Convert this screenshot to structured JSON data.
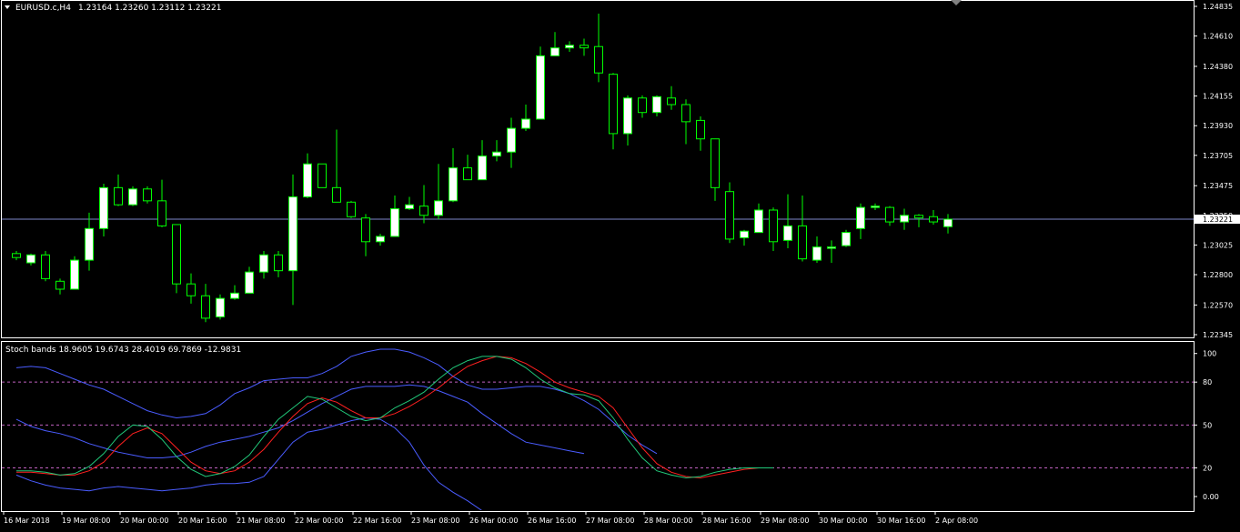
{
  "header": {
    "symbol_label": "EURUSD.c,H4",
    "ohlc": "1.23164 1.23260 1.23112 1.23221"
  },
  "indicator": {
    "label": "Stoch bands 18.9605 19.6743 28.4019 69.7869 -12.9831",
    "levels": [
      "100",
      "80",
      "50",
      "20",
      "0.00"
    ],
    "level_values": [
      100,
      80,
      50,
      20,
      0
    ]
  },
  "colors": {
    "background": "#000000",
    "frame": "#ffffff",
    "bull_body": "#ffffff",
    "wick": "#00ff00",
    "current_price_line": "#7b86c8",
    "price_tag_bg": "#ffffff",
    "band_line": "#4a5cff",
    "stoch_main": "#21c97a",
    "stoch_signal": "#ff2020",
    "level_line": "#c060c0"
  },
  "price_axis": {
    "labels": [
      "1.24835",
      "1.24610",
      "1.24380",
      "1.24155",
      "1.23930",
      "1.23705",
      "1.23475",
      "1.23250",
      "1.23025",
      "1.22800",
      "1.22570",
      "1.22345"
    ],
    "values": [
      1.24835,
      1.2461,
      1.2438,
      1.24155,
      1.2393,
      1.23705,
      1.23475,
      1.2325,
      1.23025,
      1.228,
      1.2257,
      1.22345
    ],
    "current_price": "1.23221",
    "current_value": 1.23221
  },
  "time_axis": {
    "labels": [
      "16 Mar 2018",
      "19 Mar 08:00",
      "20 Mar 00:00",
      "20 Mar 16:00",
      "21 Mar 08:00",
      "22 Mar 00:00",
      "22 Mar 16:00",
      "23 Mar 08:00",
      "26 Mar 00:00",
      "26 Mar 16:00",
      "27 Mar 08:00",
      "28 Mar 00:00",
      "28 Mar 16:00",
      "29 Mar 08:00",
      "30 Mar 00:00",
      "30 Mar 16:00",
      "2 Apr 08:00"
    ],
    "bar_index": [
      0,
      4,
      8,
      12,
      16,
      20,
      24,
      28,
      32,
      36,
      40,
      44,
      48,
      52,
      56,
      60,
      64
    ]
  },
  "chart_data": {
    "type": "candlestick",
    "symbol": "EURUSD.c",
    "timeframe": "H4",
    "ylim": [
      1.22345,
      1.24835
    ],
    "candles": [
      {
        "o": 1.2296,
        "h": 1.2298,
        "l": 1.2291,
        "c": 1.2293
      },
      {
        "o": 1.2289,
        "h": 1.2296,
        "l": 1.2287,
        "c": 1.2295
      },
      {
        "o": 1.2295,
        "h": 1.2298,
        "l": 1.2275,
        "c": 1.2277
      },
      {
        "o": 1.2275,
        "h": 1.2277,
        "l": 1.2265,
        "c": 1.2269
      },
      {
        "o": 1.2269,
        "h": 1.2294,
        "l": 1.2269,
        "c": 1.2291
      },
      {
        "o": 1.2291,
        "h": 1.2327,
        "l": 1.2283,
        "c": 1.2315
      },
      {
        "o": 1.2315,
        "h": 1.2349,
        "l": 1.2309,
        "c": 1.2346
      },
      {
        "o": 1.2346,
        "h": 1.2356,
        "l": 1.2332,
        "c": 1.2333
      },
      {
        "o": 1.2333,
        "h": 1.2347,
        "l": 1.2332,
        "c": 1.2345
      },
      {
        "o": 1.2345,
        "h": 1.2347,
        "l": 1.2334,
        "c": 1.2336
      },
      {
        "o": 1.2336,
        "h": 1.2352,
        "l": 1.2316,
        "c": 1.2317
      },
      {
        "o": 1.2318,
        "h": 1.2318,
        "l": 1.2266,
        "c": 1.2273
      },
      {
        "o": 1.2273,
        "h": 1.2281,
        "l": 1.2258,
        "c": 1.2264
      },
      {
        "o": 1.2264,
        "h": 1.2273,
        "l": 1.2244,
        "c": 1.2247
      },
      {
        "o": 1.2248,
        "h": 1.2265,
        "l": 1.2246,
        "c": 1.2262
      },
      {
        "o": 1.2262,
        "h": 1.2272,
        "l": 1.2261,
        "c": 1.2266
      },
      {
        "o": 1.2266,
        "h": 1.2286,
        "l": 1.2266,
        "c": 1.2282
      },
      {
        "o": 1.2282,
        "h": 1.2298,
        "l": 1.2277,
        "c": 1.2295
      },
      {
        "o": 1.2295,
        "h": 1.2298,
        "l": 1.2278,
        "c": 1.2283
      },
      {
        "o": 1.2283,
        "h": 1.2356,
        "l": 1.2257,
        "c": 1.2339
      },
      {
        "o": 1.2339,
        "h": 1.2372,
        "l": 1.2338,
        "c": 1.2364
      },
      {
        "o": 1.2364,
        "h": 1.2364,
        "l": 1.2346,
        "c": 1.2346
      },
      {
        "o": 1.2346,
        "h": 1.239,
        "l": 1.2335,
        "c": 1.2335
      },
      {
        "o": 1.2335,
        "h": 1.2336,
        "l": 1.2323,
        "c": 1.2324
      },
      {
        "o": 1.2323,
        "h": 1.2326,
        "l": 1.2294,
        "c": 1.2305
      },
      {
        "o": 1.2305,
        "h": 1.2311,
        "l": 1.2302,
        "c": 1.2309
      },
      {
        "o": 1.2309,
        "h": 1.234,
        "l": 1.2309,
        "c": 1.233
      },
      {
        "o": 1.233,
        "h": 1.2339,
        "l": 1.2329,
        "c": 1.2333
      },
      {
        "o": 1.2332,
        "h": 1.2348,
        "l": 1.2319,
        "c": 1.2325
      },
      {
        "o": 1.2325,
        "h": 1.2364,
        "l": 1.2322,
        "c": 1.2336
      },
      {
        "o": 1.2336,
        "h": 1.2376,
        "l": 1.2335,
        "c": 1.2361
      },
      {
        "o": 1.2361,
        "h": 1.2371,
        "l": 1.2352,
        "c": 1.2352
      },
      {
        "o": 1.2352,
        "h": 1.2382,
        "l": 1.2352,
        "c": 1.237
      },
      {
        "o": 1.237,
        "h": 1.2382,
        "l": 1.2366,
        "c": 1.2373
      },
      {
        "o": 1.2373,
        "h": 1.2399,
        "l": 1.2361,
        "c": 1.2391
      },
      {
        "o": 1.2391,
        "h": 1.2409,
        "l": 1.2389,
        "c": 1.2398
      },
      {
        "o": 1.2398,
        "h": 1.2453,
        "l": 1.2398,
        "c": 1.2446
      },
      {
        "o": 1.2446,
        "h": 1.2464,
        "l": 1.2446,
        "c": 1.2452
      },
      {
        "o": 1.2452,
        "h": 1.2457,
        "l": 1.2449,
        "c": 1.2454
      },
      {
        "o": 1.2454,
        "h": 1.2459,
        "l": 1.2446,
        "c": 1.2452
      },
      {
        "o": 1.2453,
        "h": 1.2478,
        "l": 1.2426,
        "c": 1.2433
      },
      {
        "o": 1.2432,
        "h": 1.2433,
        "l": 1.2375,
        "c": 1.2387
      },
      {
        "o": 1.2387,
        "h": 1.2416,
        "l": 1.2378,
        "c": 1.2414
      },
      {
        "o": 1.2414,
        "h": 1.2416,
        "l": 1.2399,
        "c": 1.2403
      },
      {
        "o": 1.2403,
        "h": 1.2416,
        "l": 1.24,
        "c": 1.2415
      },
      {
        "o": 1.2414,
        "h": 1.2423,
        "l": 1.2405,
        "c": 1.2409
      },
      {
        "o": 1.2409,
        "h": 1.2413,
        "l": 1.2379,
        "c": 1.2396
      },
      {
        "o": 1.2397,
        "h": 1.24,
        "l": 1.2374,
        "c": 1.2383
      },
      {
        "o": 1.2383,
        "h": 1.2383,
        "l": 1.2336,
        "c": 1.2346
      },
      {
        "o": 1.2343,
        "h": 1.235,
        "l": 1.2304,
        "c": 1.2307
      },
      {
        "o": 1.2308,
        "h": 1.2314,
        "l": 1.2302,
        "c": 1.2313
      },
      {
        "o": 1.2312,
        "h": 1.2334,
        "l": 1.2312,
        "c": 1.2329
      },
      {
        "o": 1.2329,
        "h": 1.2331,
        "l": 1.2298,
        "c": 1.2305
      },
      {
        "o": 1.2306,
        "h": 1.2341,
        "l": 1.23,
        "c": 1.2317
      },
      {
        "o": 1.2317,
        "h": 1.234,
        "l": 1.229,
        "c": 1.2292
      },
      {
        "o": 1.2291,
        "h": 1.2309,
        "l": 1.2289,
        "c": 1.2301
      },
      {
        "o": 1.2301,
        "h": 1.2306,
        "l": 1.2289,
        "c": 1.2301
      },
      {
        "o": 1.2302,
        "h": 1.2314,
        "l": 1.2301,
        "c": 1.2312
      },
      {
        "o": 1.2315,
        "h": 1.2334,
        "l": 1.2307,
        "c": 1.2331
      },
      {
        "o": 1.2331,
        "h": 1.2334,
        "l": 1.2329,
        "c": 1.2332
      },
      {
        "o": 1.2331,
        "h": 1.2332,
        "l": 1.2317,
        "c": 1.232
      },
      {
        "o": 1.232,
        "h": 1.233,
        "l": 1.2314,
        "c": 1.2325
      },
      {
        "o": 1.2325,
        "h": 1.2326,
        "l": 1.2316,
        "c": 1.2323
      },
      {
        "o": 1.2324,
        "h": 1.2329,
        "l": 1.2318,
        "c": 1.232
      },
      {
        "o": 1.23164,
        "h": 1.2326,
        "l": 1.23112,
        "c": 1.23221
      }
    ],
    "indicator_series": {
      "ylim": [
        -5,
        105
      ],
      "main": [
        18,
        18,
        17,
        15,
        16,
        21,
        30,
        42,
        50,
        49,
        40,
        28,
        19,
        14,
        16,
        21,
        29,
        42,
        54,
        62,
        70,
        68,
        62,
        56,
        53,
        55,
        62,
        67,
        73,
        82,
        90,
        95,
        98,
        98,
        96,
        90,
        82,
        76,
        72,
        71,
        67,
        55,
        40,
        27,
        18,
        15,
        13,
        14,
        17,
        19,
        20,
        20,
        20
      ],
      "signal": [
        17,
        17,
        16,
        15,
        15,
        18,
        24,
        35,
        44,
        48,
        44,
        34,
        24,
        18,
        16,
        18,
        24,
        33,
        45,
        56,
        65,
        69,
        66,
        60,
        55,
        55,
        58,
        63,
        69,
        76,
        84,
        91,
        95,
        98,
        97,
        93,
        87,
        80,
        76,
        73,
        70,
        62,
        48,
        34,
        23,
        17,
        14,
        13,
        15,
        17,
        19,
        20,
        20
      ],
      "upper_band": [
        90,
        91,
        90,
        86,
        82,
        78,
        75,
        70,
        65,
        60,
        57,
        55,
        56,
        58,
        64,
        72,
        76,
        81,
        82,
        83,
        83,
        86,
        91,
        98,
        101,
        103,
        103,
        101,
        97,
        92,
        84,
        78,
        75,
        75,
        76,
        77,
        77,
        75,
        72,
        67,
        61,
        52,
        43,
        36,
        30
      ],
      "mid_band": [
        54,
        49,
        46,
        44,
        41,
        37,
        34,
        31,
        29,
        27,
        27,
        28,
        31,
        35,
        38,
        40,
        42,
        45,
        48,
        53,
        59,
        65,
        70,
        75,
        77,
        77,
        77,
        78,
        77,
        74,
        70,
        66,
        58,
        51,
        44,
        38,
        36,
        34,
        32,
        30
      ],
      "lower_band": [
        15,
        11,
        8,
        6,
        5,
        4,
        6,
        7,
        6,
        5,
        4,
        5,
        6,
        8,
        9,
        9,
        10,
        14,
        26,
        38,
        45,
        47,
        50,
        53,
        55,
        54,
        48,
        38,
        22,
        10,
        3,
        -3,
        -10,
        -16,
        -22,
        -28
      ],
      "upper_start_bar": 0,
      "mid_start_bar": 0,
      "lower_start_bar": 0
    }
  }
}
